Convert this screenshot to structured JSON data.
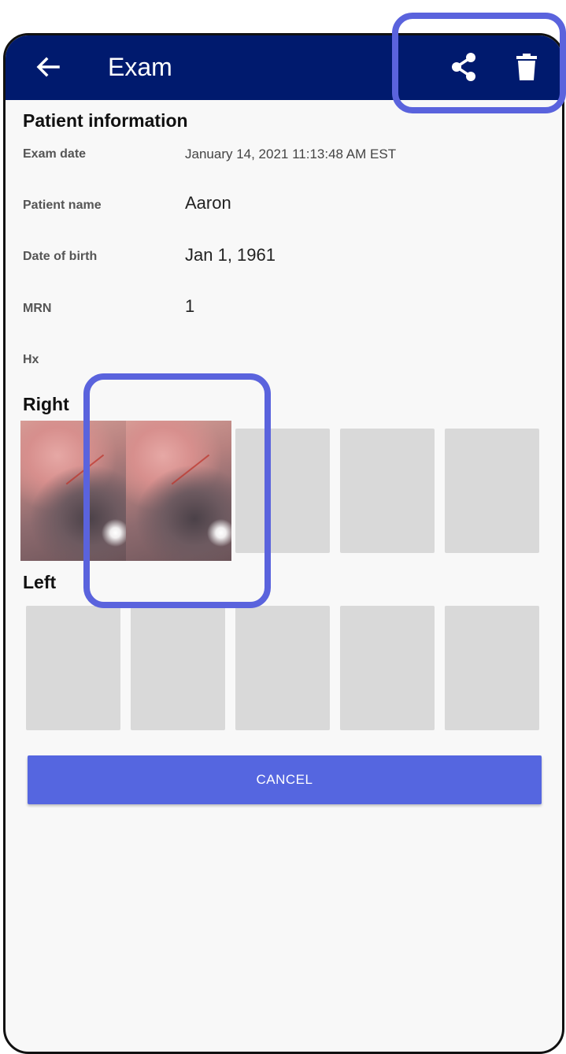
{
  "appbar": {
    "title": "Exam",
    "icons": {
      "back": "arrow-left-icon",
      "share": "share-icon",
      "delete": "trash-icon"
    }
  },
  "patient_info": {
    "heading": "Patient information",
    "fields": [
      {
        "label": "Exam date",
        "value": "January 14, 2021 11:13:48 AM EST"
      },
      {
        "label": "Patient name",
        "value": "Aaron"
      },
      {
        "label": "Date of birth",
        "value": "Jan 1, 1961"
      },
      {
        "label": "MRN",
        "value": "1"
      },
      {
        "label": "Hx",
        "value": ""
      }
    ]
  },
  "right": {
    "heading": "Right",
    "captured": 2,
    "slots": 5
  },
  "left": {
    "heading": "Left",
    "captured": 0,
    "slots": 5
  },
  "actions": {
    "cancel_label": "CANCEL"
  },
  "colors": {
    "appbar": "#001a6e",
    "accent": "#5566e0",
    "highlight": "#5a63dd",
    "placeholder": "#d9d9d9"
  }
}
